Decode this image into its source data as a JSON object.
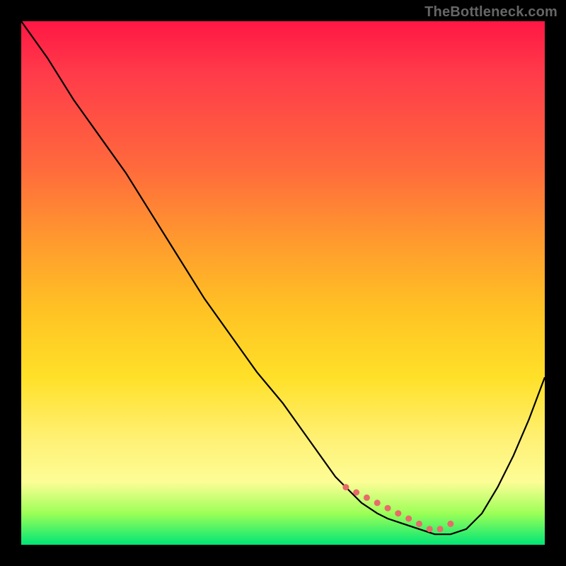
{
  "watermark": "TheBottleneck.com",
  "colors": {
    "background": "#000000",
    "curve": "#000000",
    "marker": "#e96a6a",
    "gradient_stops": [
      "#ff1744",
      "#ff6a3c",
      "#ffc224",
      "#fff176",
      "#00e676"
    ]
  },
  "chart_data": {
    "type": "line",
    "title": "",
    "xlabel": "",
    "ylabel": "",
    "xlim": [
      0,
      100
    ],
    "ylim": [
      0,
      100
    ],
    "grid": false,
    "legend": false,
    "series": [
      {
        "name": "bottleneck-curve",
        "x": [
          0,
          5,
          10,
          15,
          20,
          25,
          30,
          35,
          40,
          45,
          50,
          55,
          60,
          62,
          65,
          68,
          70,
          73,
          76,
          79,
          82,
          85,
          88,
          91,
          94,
          97,
          100
        ],
        "values": [
          100,
          93,
          85,
          78,
          71,
          63,
          55,
          47,
          40,
          33,
          27,
          20,
          13,
          11,
          8,
          6,
          5,
          4,
          3,
          2,
          2,
          3,
          6,
          11,
          17,
          24,
          32
        ]
      }
    ],
    "markers": {
      "name": "flat-minimum-dots",
      "x": [
        62,
        64,
        66,
        68,
        70,
        72,
        74,
        76,
        78,
        80,
        82
      ],
      "values": [
        11,
        10,
        9,
        8,
        7,
        6,
        5,
        4,
        3,
        3,
        4
      ]
    }
  }
}
